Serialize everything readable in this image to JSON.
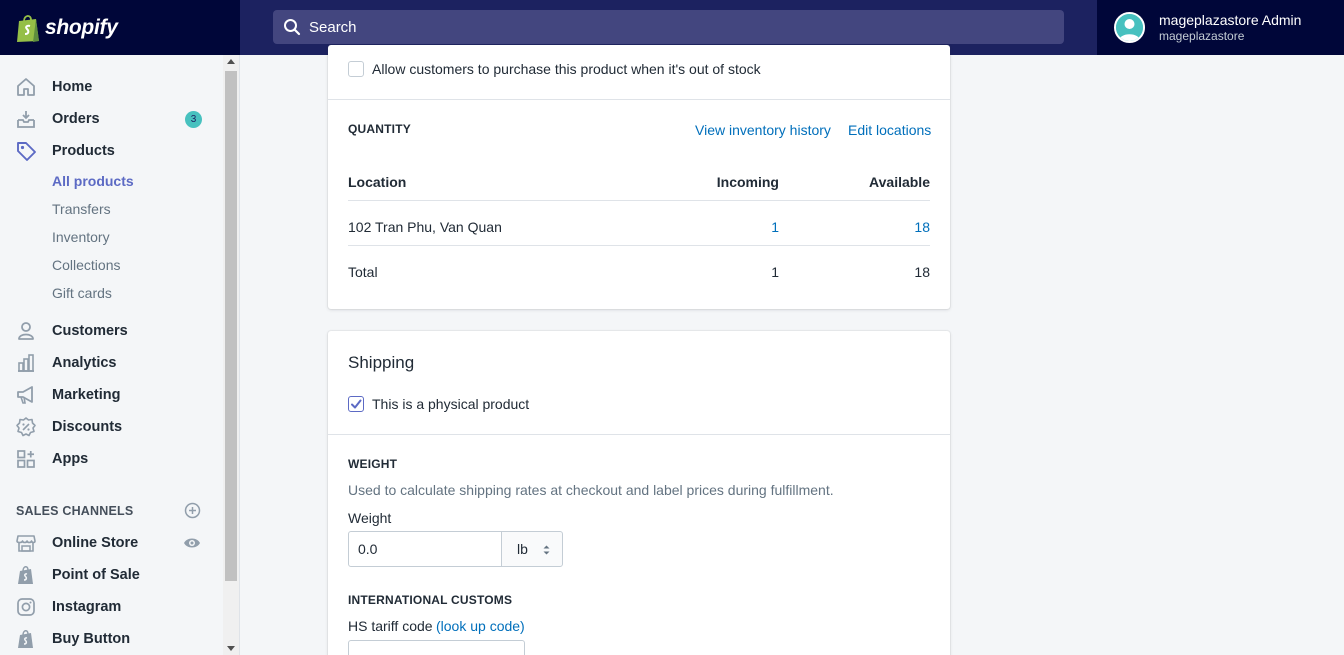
{
  "app": {
    "brand": "shopify"
  },
  "search": {
    "placeholder": "Search"
  },
  "user": {
    "name": "mageplazastore Admin",
    "store": "mageplazastore"
  },
  "sidebar": {
    "items": [
      {
        "label": "Home",
        "icon": "home-icon"
      },
      {
        "label": "Orders",
        "icon": "orders-icon",
        "badge": "3"
      },
      {
        "label": "Products",
        "icon": "tag-icon"
      },
      {
        "label": "Customers",
        "icon": "customer-icon"
      },
      {
        "label": "Analytics",
        "icon": "analytics-icon"
      },
      {
        "label": "Marketing",
        "icon": "megaphone-icon"
      },
      {
        "label": "Discounts",
        "icon": "discount-icon"
      },
      {
        "label": "Apps",
        "icon": "apps-icon"
      }
    ],
    "product_subitems": [
      "All products",
      "Transfers",
      "Inventory",
      "Collections",
      "Gift cards"
    ],
    "sales_channels_title": "SALES CHANNELS",
    "channels": [
      {
        "label": "Online Store",
        "icon": "store-icon"
      },
      {
        "label": "Point of Sale",
        "icon": "pos-icon"
      },
      {
        "label": "Instagram",
        "icon": "instagram-icon"
      },
      {
        "label": "Buy Button",
        "icon": "buy-button-icon"
      }
    ]
  },
  "inventory": {
    "oos_label": "Allow customers to purchase this product when it's out of stock",
    "quantity_title": "QUANTITY",
    "view_history": "View inventory history",
    "edit_locations": "Edit locations",
    "columns": [
      "Location",
      "Incoming",
      "Available"
    ],
    "rows": [
      {
        "location": "102 Tran Phu, Van Quan",
        "incoming": "1",
        "available": "18"
      }
    ],
    "total": {
      "label": "Total",
      "incoming": "1",
      "available": "18"
    }
  },
  "shipping": {
    "title": "Shipping",
    "physical_label": "This is a physical product",
    "weight_title": "WEIGHT",
    "weight_help": "Used to calculate shipping rates at checkout and label prices during fulfillment.",
    "weight_label": "Weight",
    "weight_value": "0.0",
    "weight_unit": "lb",
    "customs_title": "INTERNATIONAL CUSTOMS",
    "hs_label": "HS tariff code",
    "hs_link": "(look up code)"
  },
  "colors": {
    "accent": "#5c6ac4",
    "link": "#006fbb",
    "topbar": "#1c2260",
    "badge": "#47c1bf"
  }
}
